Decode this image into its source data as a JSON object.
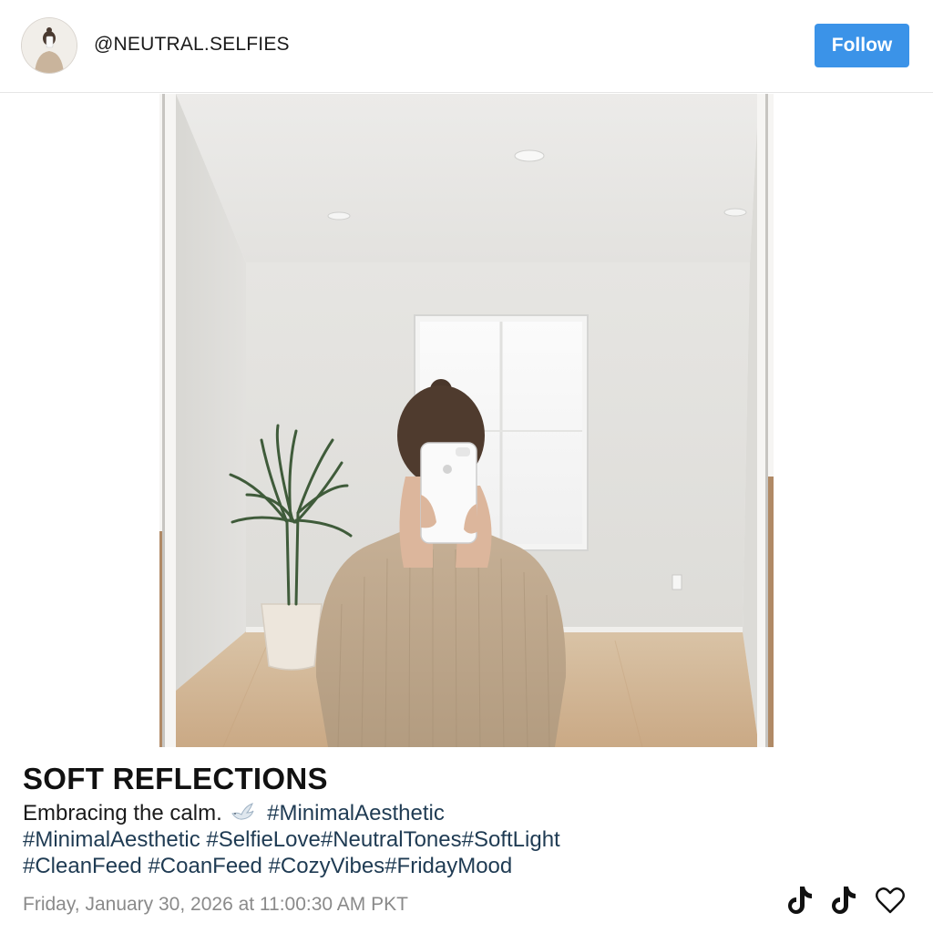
{
  "header": {
    "username": "@NEUTRAL.SELFIES",
    "follow_label": "Follow",
    "avatar_icon": "avatar-icon"
  },
  "post": {
    "title": "SOFT REFLECTIONS",
    "caption_lead": "Embracing the calm.",
    "caption_emoji_icon": "dove-icon",
    "hashtags_line1": [
      "#MinimalAesthetic"
    ],
    "hashtags_line2": [
      "#MinimalAesthetic",
      "#SelfieLove",
      "#NeutralTones",
      "#SoftLight"
    ],
    "hashtags_line3": [
      "#CleanFeed",
      "#CoanFeed",
      "#CozyVibes",
      "#FridayMood"
    ],
    "timestamp": "Friday, January 30, 2026 at 11:00:30 AM PKT"
  },
  "actions": [
    {
      "icon": "tiktok-icon"
    },
    {
      "icon": "tiktok-icon"
    },
    {
      "icon": "heart-icon"
    }
  ],
  "colors": {
    "follow_button": "#3b93e8",
    "hashtag": "#1f3b53",
    "timestamp": "#8a8a8a"
  }
}
